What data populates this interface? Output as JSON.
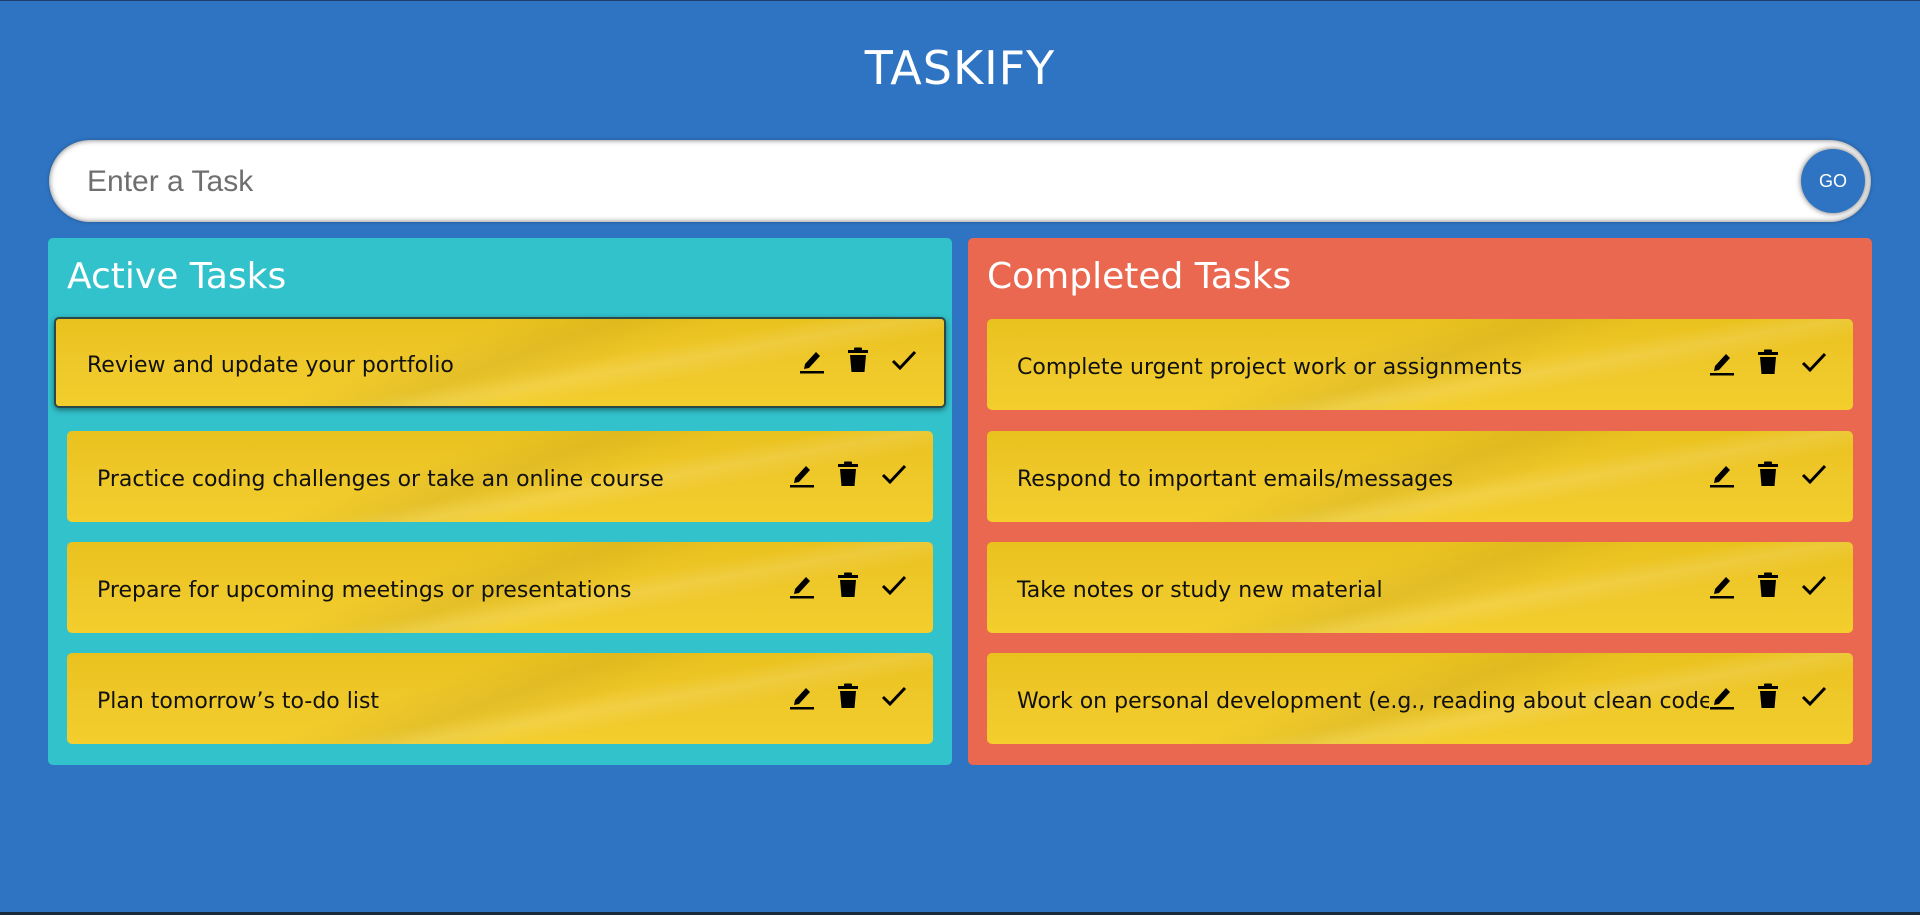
{
  "app": {
    "title": "TASKIFY"
  },
  "input": {
    "placeholder": "Enter a Task",
    "value": "",
    "go_label": "GO"
  },
  "active": {
    "title": "Active Tasks",
    "tasks": [
      "Review and update your portfolio",
      "Practice coding challenges or take an online course",
      "Prepare for upcoming meetings or presentations",
      "Plan tomorrow’s to-do list"
    ]
  },
  "completed": {
    "title": "Completed Tasks",
    "tasks": [
      "Complete urgent project work or assignments",
      "Respond to important emails/messages",
      "Take notes or study new material",
      "Work on personal development (e.g., reading about clean code practices)"
    ]
  },
  "icons": [
    "edit-icon",
    "delete-icon",
    "done-icon"
  ],
  "colors": {
    "background": "#2f74c3",
    "active_panel": "#32c2cc",
    "completed_panel": "#eb6850",
    "card": "#efc82a"
  }
}
